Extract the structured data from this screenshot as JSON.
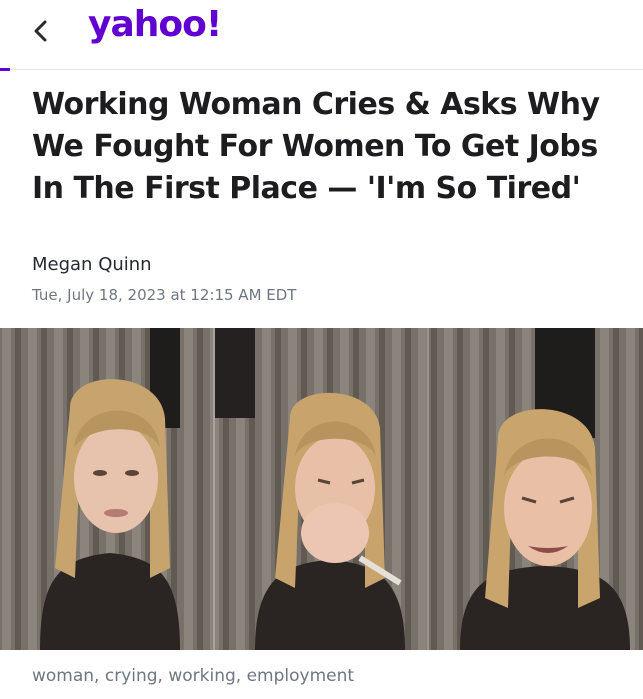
{
  "header": {
    "back_icon": "chevron-left-icon",
    "logo_text": "yahoo!",
    "brand_color": "#6001d2"
  },
  "article": {
    "headline": "Working Woman Cries & Asks Why We Fought For Women To Get Jobs In The First Place — 'I'm So Tired'",
    "author": "Megan Quinn",
    "date": "Tue, July 18, 2023 at 12:15 AM EDT"
  },
  "image": {
    "panels": [
      "tired-expression",
      "covering-mouth-crying",
      "crying"
    ],
    "caption": "woman, crying, working, employment"
  }
}
